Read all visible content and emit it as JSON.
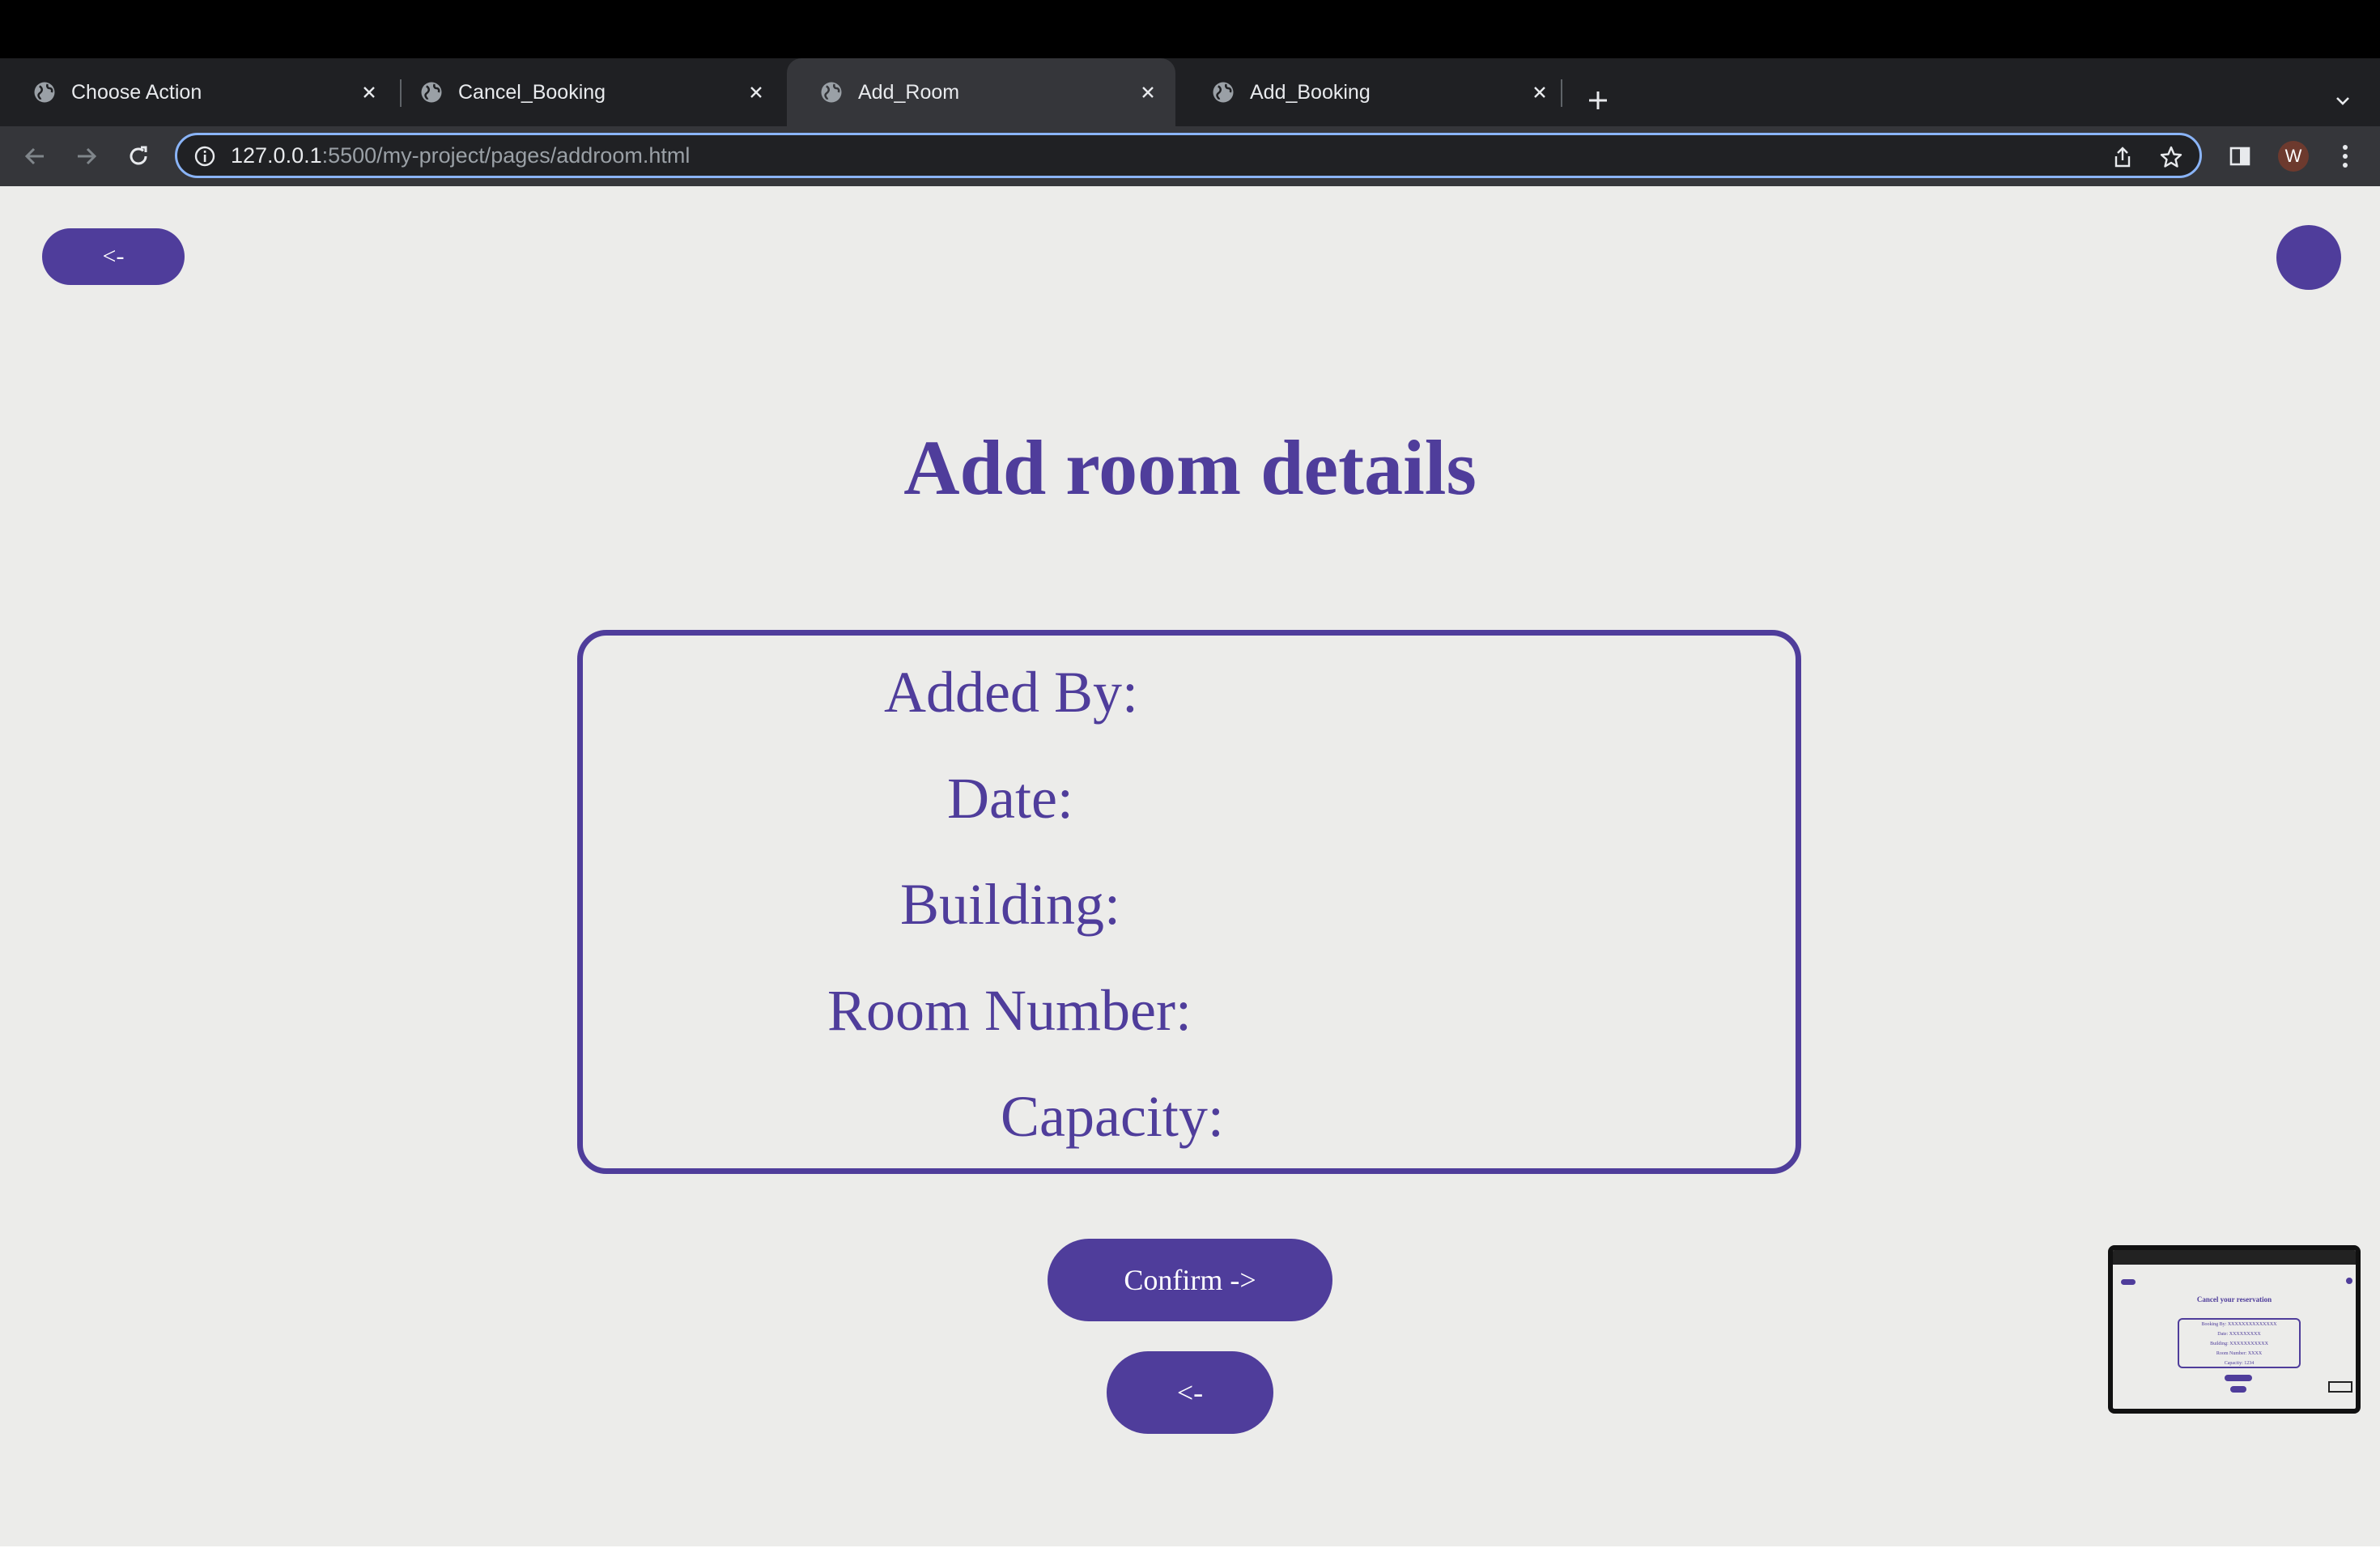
{
  "browser": {
    "tabs": [
      {
        "title": "Choose Action",
        "active": false
      },
      {
        "title": "Cancel_Booking",
        "active": false
      },
      {
        "title": "Add_Room",
        "active": true
      },
      {
        "title": "Add_Booking",
        "active": false
      }
    ],
    "url_host": "127.0.0.1",
    "url_rest": ":5500/my-project/pages/addroom.html",
    "profile_initial": "W"
  },
  "page": {
    "back_top_label": "<-",
    "title": "Add room details",
    "fields": [
      {
        "label": "Added By:",
        "value": ""
      },
      {
        "label": "Date:",
        "value": ""
      },
      {
        "label": "Building:",
        "value": ""
      },
      {
        "label": "Room Number:",
        "value": ""
      },
      {
        "label": "Capacity:",
        "value": ""
      }
    ],
    "confirm_label": "Confirm ->",
    "back_bottom_label": "<-"
  },
  "thumbnail": {
    "title": "Cancel your reservation",
    "lines": [
      "Booking By: XXXXXXXXXXXXXX",
      "Date: XXXXXXXXX",
      "Building: XXXXXXXXXXX",
      "Room Number: XXXX",
      "Capacity: 1234"
    ]
  },
  "colors": {
    "accent": "#4f3d9b",
    "page_bg": "#ececea",
    "field_border": "#3a2d86"
  }
}
